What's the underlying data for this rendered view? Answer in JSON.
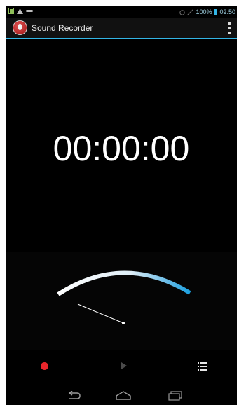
{
  "status_bar": {
    "battery_percent": "100%",
    "time": "02:50",
    "icons": [
      "notification-icon",
      "warning-icon",
      "usb-icon",
      "alarm-icon",
      "signal-icon",
      "battery-icon"
    ]
  },
  "action_bar": {
    "app_icon": "microphone-icon",
    "title": "Sound Recorder",
    "menu_icon": "overflow-menu-icon"
  },
  "timer": {
    "elapsed": "00:00:00"
  },
  "level_meter": {
    "level": 0,
    "arc_colors": [
      "#ffffff",
      "#33b5e5"
    ],
    "needle_color": "#ffffff"
  },
  "controls": {
    "record_icon": "record-icon",
    "play_icon": "play-icon",
    "list_icon": "list-icon",
    "record_color": "#e8262b"
  },
  "nav_bar": {
    "back_icon": "back-icon",
    "home_icon": "home-icon",
    "recents_icon": "recents-icon"
  },
  "colors": {
    "accent": "#33b5e5",
    "background": "#000000"
  }
}
